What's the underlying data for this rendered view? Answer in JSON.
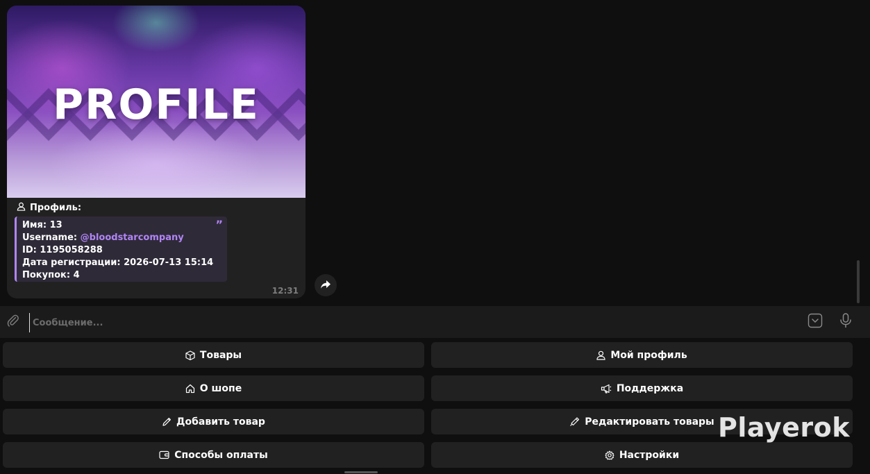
{
  "message": {
    "image_text": "PROFILE",
    "caption": "Профиль:",
    "quote_mark": "”",
    "fields": {
      "name_label": "Имя: ",
      "name_value": "13",
      "username_label": "Username: ",
      "username_value": "@bloodstarcompany",
      "id_label": "ID: ",
      "id_value": "1195058288",
      "reg_label": "Дата регистрации: ",
      "reg_value": "2026-07-13 15:14",
      "purchases_label": "Покупок: ",
      "purchases_value": "4"
    },
    "time": "12:31"
  },
  "input": {
    "placeholder": "Сообщение..."
  },
  "keyboard": {
    "products": "Товары",
    "my_profile": "Мой профиль",
    "about_shop": "О шопе",
    "support": "Поддержка",
    "add_product": "Добавить товар",
    "edit_products": "Редактировать товары",
    "payment_methods": "Способы оплаты",
    "settings": "Настройки"
  },
  "watermark": "Playerok",
  "colors": {
    "accent": "#b085f5",
    "bubble": "#212121",
    "background": "#0f0f0f"
  },
  "icons": {
    "caption": "user-icon",
    "share": "share-arrow-icon",
    "attach": "paperclip-icon",
    "keyboard_toggle": "keyboard-toggle-icon",
    "mic": "microphone-icon"
  }
}
